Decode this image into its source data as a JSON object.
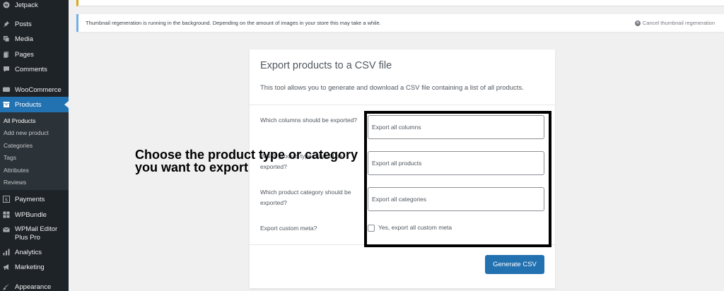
{
  "sidebar": {
    "items": [
      {
        "label": "Jetpack",
        "icon": "jetpack-icon"
      },
      {
        "label": "Posts",
        "icon": "pushpin-icon"
      },
      {
        "label": "Media",
        "icon": "media-icon"
      },
      {
        "label": "Pages",
        "icon": "pages-icon"
      },
      {
        "label": "Comments",
        "icon": "comment-icon"
      },
      {
        "label": "WooCommerce",
        "icon": "woocommerce-icon"
      },
      {
        "label": "Products",
        "icon": "archive-icon"
      },
      {
        "label": "Payments",
        "icon": "dollar-icon"
      },
      {
        "label": "WPBundle",
        "icon": "grid-icon"
      },
      {
        "label": "WPMail Editor Plus Pro",
        "icon": "mail-icon"
      },
      {
        "label": "Analytics",
        "icon": "bar-chart-icon"
      },
      {
        "label": "Marketing",
        "icon": "megaphone-icon"
      },
      {
        "label": "Appearance",
        "icon": "brush-icon"
      }
    ],
    "submenu": [
      {
        "label": "All Products"
      },
      {
        "label": "Add new product"
      },
      {
        "label": "Categories"
      },
      {
        "label": "Tags"
      },
      {
        "label": "Attributes"
      },
      {
        "label": "Reviews"
      }
    ]
  },
  "notice": {
    "text": "Thumbnail regeneration is running in the background. Depending on the amount of images in your store this may take a while.",
    "cancel_label": "Cancel thumbnail regeneration"
  },
  "export": {
    "title": "Export products to a CSV file",
    "description": "This tool allows you to generate and download a CSV file containing a list of all products.",
    "rows": [
      {
        "label": "Which columns should be exported?",
        "value": "Export all columns"
      },
      {
        "label": "Which product types should be exported?",
        "value": "Export all products"
      },
      {
        "label": "Which product category should be exported?",
        "value": "Export all categories"
      }
    ],
    "meta_label": "Export custom meta?",
    "meta_checkbox_label": "Yes, export all custom meta",
    "generate_label": "Generate CSV"
  },
  "annotation": {
    "text": "Choose the product type or category you want to export"
  },
  "colors": {
    "sidebar_bg": "#1d2327",
    "accent": "#2271b1",
    "notice_border": "#72aee6"
  }
}
